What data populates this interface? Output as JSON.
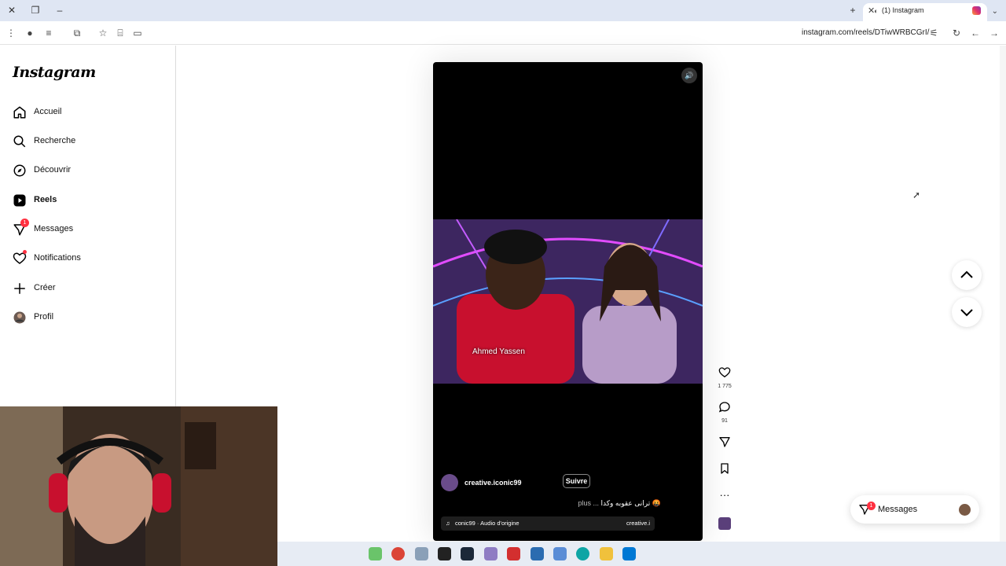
{
  "browser": {
    "tab_title": "(1) Instagram",
    "url": "instagram.com/reels/DTiwWRBCGrI/"
  },
  "sidebar": {
    "logo": "Instagram",
    "items": [
      {
        "label": "Accueil",
        "icon": "home-icon"
      },
      {
        "label": "Recherche",
        "icon": "search-icon"
      },
      {
        "label": "Découvrir",
        "icon": "compass-icon"
      },
      {
        "label": "Reels",
        "icon": "reels-icon"
      },
      {
        "label": "Messages",
        "icon": "messenger-icon",
        "badge": "1"
      },
      {
        "label": "Notifications",
        "icon": "heart-icon"
      },
      {
        "label": "Créer",
        "icon": "plus-icon"
      },
      {
        "label": "Profil",
        "icon": "avatar"
      }
    ]
  },
  "reel": {
    "overlay_name": "Ahmed Yassen",
    "username": "creative.iconic99",
    "follow_label": "Suivre",
    "description": "ترانی عقوبه وكدا 🤬",
    "more_label": "plus ...",
    "audio_text": "conic99 · Audio d'origine",
    "audio_right": "creative.i"
  },
  "actions": {
    "likes": "1 775",
    "comments": "91"
  },
  "messages_button": {
    "label": "Messages",
    "badge": "1"
  },
  "colors": {
    "badge": "#ff3040",
    "text": "#000000"
  }
}
